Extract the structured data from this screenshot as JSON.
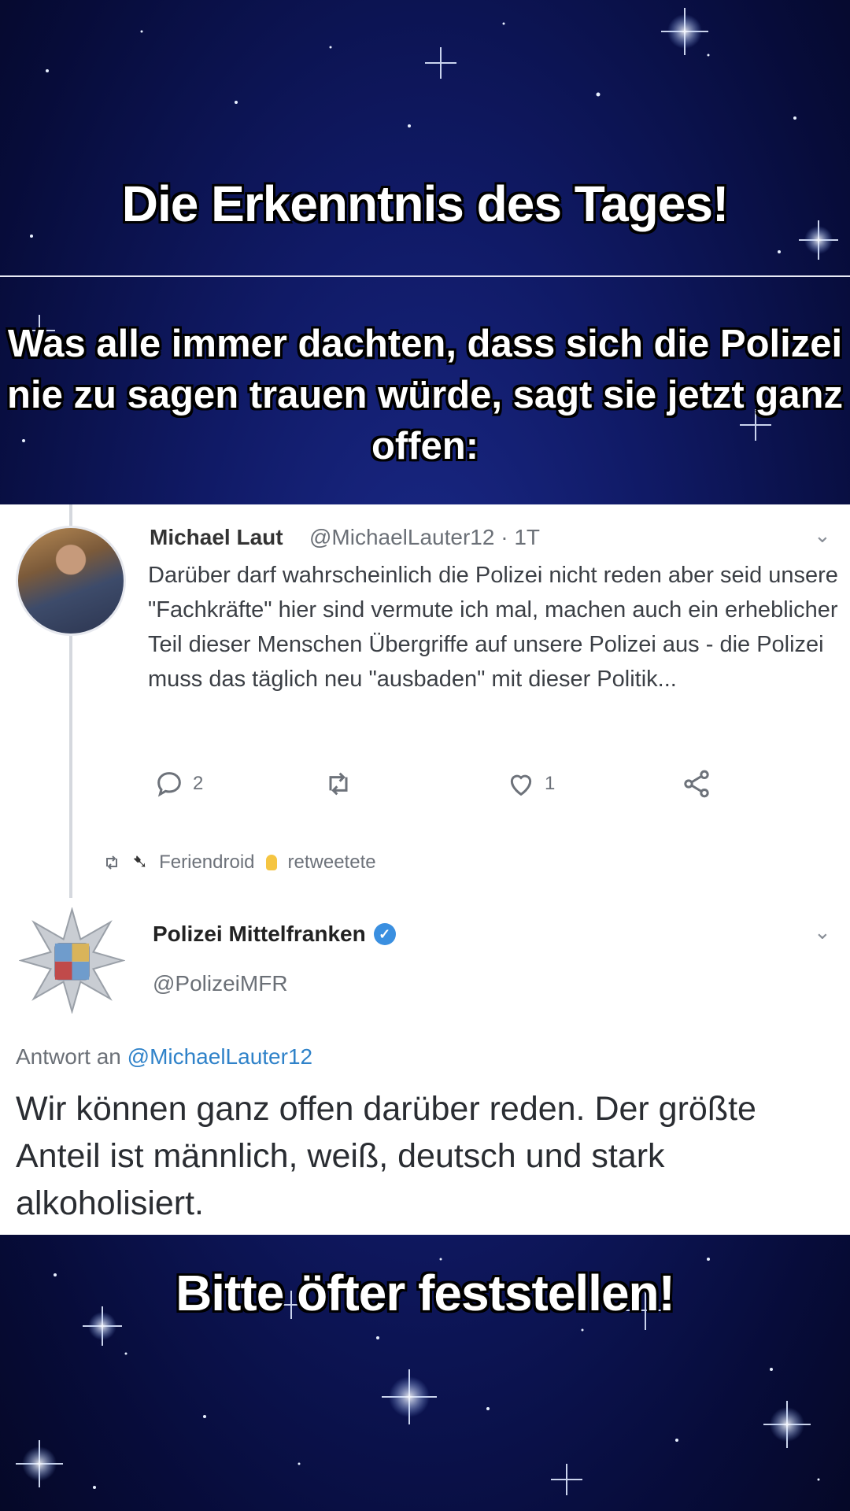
{
  "captions": {
    "headline": "Die Erkenntnis des Tages!",
    "subline": "Was alle immer dachten, dass sich die Polizei nie zu sagen trauen würde, sagt sie jetzt ganz offen:",
    "footline": "Bitte öfter feststellen!"
  },
  "tweet1": {
    "name": "Michael Laut",
    "handle": "@MichaelLauter12 · 1T",
    "body": "Darüber darf wahrscheinlich die Polizei nicht reden aber seid unsere \"Fachkräfte\" hier sind vermute ich mal, machen auch ein erheblicher Teil dieser Menschen Übergriffe auf unsere Polizei aus   - die Polizei muss das täglich neu \"ausbaden\" mit dieser Politik...",
    "reply_count": "2",
    "like_count": "1",
    "retweet_by": "Feriendroid",
    "retweet_label": "retweetete"
  },
  "tweet2": {
    "name": "Polizei Mittelfranken",
    "handle": "@PolizeiMFR",
    "reply_prefix": "Antwort an",
    "reply_to": "@MichaelLauter12",
    "body": "Wir können ganz offen darüber reden. Der größte Anteil ist männlich, weiß, deutsch und stark alkoholisiert."
  },
  "icons": [
    "reply-icon",
    "retweet-icon",
    "like-icon",
    "share-icon",
    "chevron-down-icon",
    "verified-icon",
    "police-badge-icon"
  ],
  "colors": {
    "background": "#101a66",
    "panel": "#ffffff",
    "link": "#2f82c9",
    "verified": "#3a8fe0"
  }
}
